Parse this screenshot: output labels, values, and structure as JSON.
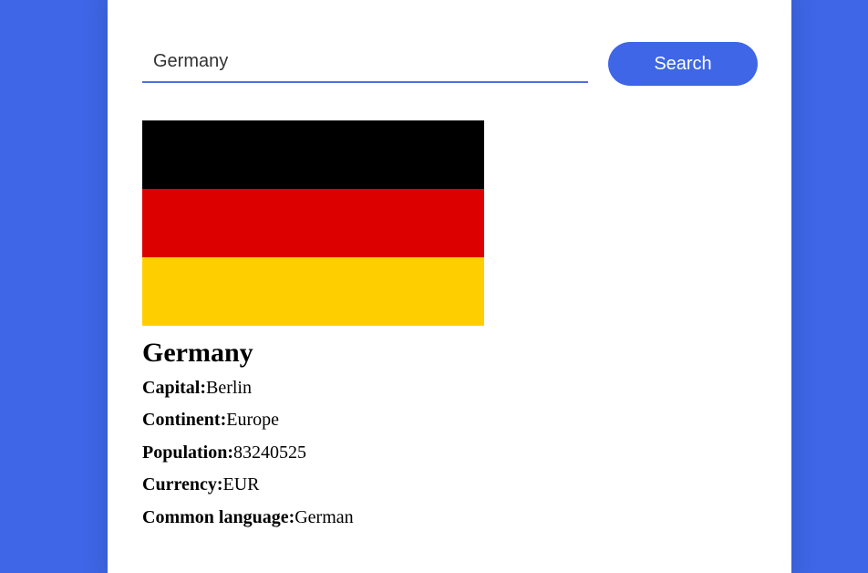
{
  "search": {
    "value": "Germany",
    "button_label": "Search"
  },
  "flag": {
    "name": "germany-flag",
    "colors": [
      "#000000",
      "#dd0000",
      "#ffce00"
    ]
  },
  "country": {
    "name": "Germany",
    "details": [
      {
        "label": "Capital:",
        "value": "Berlin"
      },
      {
        "label": "Continent:",
        "value": "Europe"
      },
      {
        "label": "Population:",
        "value": "83240525"
      },
      {
        "label": "Currency:",
        "value": "EUR"
      },
      {
        "label": "Common language:",
        "value": "German"
      }
    ]
  },
  "theme": {
    "accent": "#3e66e6",
    "card_bg": "#ffffff"
  }
}
